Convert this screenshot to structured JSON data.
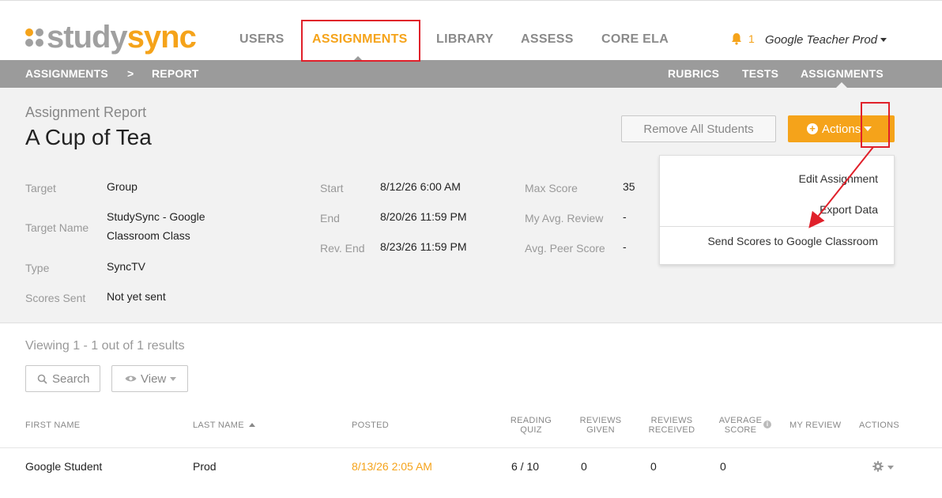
{
  "brand": {
    "logo_part1": "study",
    "logo_part2": "sync",
    "dot_colors": [
      "#f5a31a",
      "#a0a0a0",
      "#a0a0a0",
      "#a0a0a0"
    ]
  },
  "topnav": {
    "items": [
      {
        "label": "USERS"
      },
      {
        "label": "ASSIGNMENTS"
      },
      {
        "label": "LIBRARY"
      },
      {
        "label": "ASSESS"
      },
      {
        "label": "CORE ELA"
      }
    ],
    "notification_count": "1",
    "user_name": "Google Teacher Prod"
  },
  "subnav": {
    "breadcrumb": [
      "ASSIGNMENTS",
      ">",
      "REPORT"
    ],
    "right_items": [
      {
        "label": "RUBRICS"
      },
      {
        "label": "TESTS"
      },
      {
        "label": "ASSIGNMENTS"
      }
    ]
  },
  "report": {
    "label": "Assignment Report",
    "title": "A Cup of Tea",
    "remove_button": "Remove All Students",
    "actions_button": "Actions",
    "meta_left": [
      {
        "label": "Target",
        "value": "Group"
      },
      {
        "label": "Target Name",
        "value_line1": "StudySync - Google",
        "value_line2": "Classroom Class"
      },
      {
        "label": "Type",
        "value": "SyncTV"
      },
      {
        "label": "Scores Sent",
        "value": "Not yet sent"
      }
    ],
    "meta_mid": [
      {
        "label": "Start",
        "value": "8/12/26 6:00 AM"
      },
      {
        "label": "End",
        "value": "8/20/26 11:59 PM"
      },
      {
        "label": "Rev. End",
        "value": "8/23/26 11:59 PM"
      }
    ],
    "meta_right": [
      {
        "label": "Max Score",
        "value": "35"
      },
      {
        "label": "My Avg. Review",
        "value": "-"
      },
      {
        "label": "Avg. Peer Score",
        "value": "-"
      }
    ]
  },
  "actions_menu": {
    "items": [
      {
        "label": "Edit Assignment"
      },
      {
        "label": "Export Data"
      },
      {
        "label": "Send Scores to Google Classroom"
      }
    ]
  },
  "list": {
    "viewing_text": "Viewing 1 - 1 out of 1 results",
    "search_button": "Search",
    "view_button": "View",
    "columns": {
      "first_name": "FIRST NAME",
      "last_name": "LAST NAME",
      "posted": "POSTED",
      "reading_quiz_1": "READING",
      "reading_quiz_2": "QUIZ",
      "reviews_given_1": "REVIEWS",
      "reviews_given_2": "GIVEN",
      "reviews_received_1": "REVIEWS",
      "reviews_received_2": "RECEIVED",
      "average_score_1": "AVERAGE",
      "average_score_2": "SCORE",
      "my_review": "MY REVIEW",
      "actions": "ACTIONS"
    },
    "rows": [
      {
        "first_name": "Google Student",
        "last_name": "Prod",
        "posted": "8/13/26 2:05 AM",
        "reading_quiz": "6 / 10",
        "reviews_given": "0",
        "reviews_received": "0",
        "average_score": "0"
      }
    ]
  },
  "colors": {
    "accent": "#f5a31a",
    "subbar": "#9b9b9b",
    "annotation": "#e0202a"
  }
}
